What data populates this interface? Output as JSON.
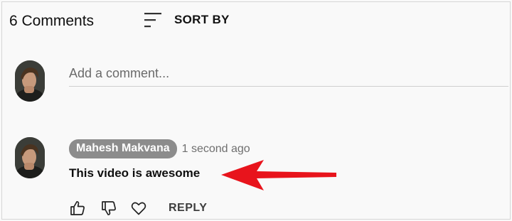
{
  "header": {
    "comment_count": "6 Comments",
    "sort_label": "SORT BY",
    "sort_icon": "sort-icon"
  },
  "composer": {
    "placeholder": "Add a comment...",
    "avatar_icon": "user-avatar"
  },
  "comments": [
    {
      "author": "Mahesh Makvana",
      "timestamp": "1 second ago",
      "text": "This video is awesome",
      "reply_label": "REPLY",
      "actions": [
        "thumbs-up-icon",
        "thumbs-down-icon",
        "heart-icon"
      ]
    }
  ],
  "colors": {
    "background": "#f9f9f9",
    "author_badge": "#8c8c8c",
    "annotation_arrow": "#e8141c",
    "divider": "#cfcfcf"
  }
}
